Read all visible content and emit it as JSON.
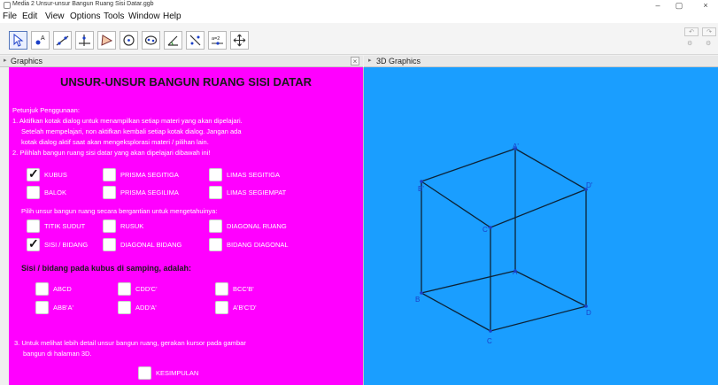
{
  "window": {
    "title": "Media 2 Unsur-unsur Bangun Ruang Sisi Datar.ggb",
    "controls": {
      "minimize": "–",
      "maximize": "▢",
      "close": "×"
    }
  },
  "menu": [
    "File",
    "Edit",
    "View",
    "Options",
    "Tools",
    "Window",
    "Help"
  ],
  "toolbar": {
    "tools": [
      {
        "icon": "move-arrow-icon"
      },
      {
        "icon": "point-icon"
      },
      {
        "icon": "line-icon"
      },
      {
        "icon": "perpendicular-line-icon"
      },
      {
        "icon": "polygon-icon"
      },
      {
        "icon": "circle-icon"
      },
      {
        "icon": "ellipse-icon"
      },
      {
        "icon": "angle-icon"
      },
      {
        "icon": "reflect-icon"
      },
      {
        "icon": "slider-icon",
        "label": "a=2"
      },
      {
        "icon": "move-view-icon"
      }
    ]
  },
  "panes": {
    "graphics": {
      "title": "Graphics",
      "close": "×"
    },
    "graphics3d": {
      "title": "3D Graphics"
    }
  },
  "content": {
    "heading": "UNSUR-UNSUR BANGUN RUANG SISI DATAR",
    "instructions": [
      "Petunjuk Penggunaan:",
      "1. Aktifkan kotak dialog untuk menampilkan setiap materi yang akan dipelajari.",
      "Setelah mempelajari, non aktifkan kembali setiap kotak dialog. Jangan ada",
      "kotak dialog aktif saat akan mengeksplorasi materi / pilihan lain.",
      "2. Pilihlah bangun ruang sisi datar yang akan dipelajari dibawah ini!"
    ],
    "shapes": [
      {
        "label": "KUBUS",
        "checked": true
      },
      {
        "label": "PRISMA SEGITIGA",
        "checked": false
      },
      {
        "label": "LIMAS SEGITIGA",
        "checked": false
      },
      {
        "label": "BALOK",
        "checked": false
      },
      {
        "label": "PRISMA SEGILIMA",
        "checked": false
      },
      {
        "label": "LIMAS SEGIEMPAT",
        "checked": false
      }
    ],
    "elements_prompt": "Pilih unsur bangun ruang secara bergantian untuk mengetahuinya:",
    "elements": [
      {
        "label": "TITIK SUDUT",
        "checked": false
      },
      {
        "label": "RUSUK",
        "checked": false
      },
      {
        "label": "DIAGONAL RUANG",
        "checked": false
      },
      {
        "label": "SISI / BIDANG",
        "checked": true
      },
      {
        "label": "DIAGONAL BIDANG",
        "checked": false
      },
      {
        "label": "BIDANG DIAGONAL",
        "checked": false
      }
    ],
    "faces_heading": "Sisi / bidang pada kubus di samping, adalah:",
    "faces": [
      {
        "label": "ABCD",
        "checked": false
      },
      {
        "label": "CDD'C'",
        "checked": false
      },
      {
        "label": "BCC'B'",
        "checked": false
      },
      {
        "label": "ABB'A'",
        "checked": false
      },
      {
        "label": "ADD'A'",
        "checked": false
      },
      {
        "label": "A'B'C'D'",
        "checked": false
      }
    ],
    "note": [
      "3. Untuk melihat lebih detail unsur bangun ruang, gerakan kursor pada gambar",
      "bangun di halaman 3D."
    ],
    "conclusion": {
      "label": "KESIMPULAN",
      "checked": false
    }
  },
  "cube": {
    "vertex_labels": [
      "A",
      "B",
      "C",
      "D",
      "A'",
      "B'",
      "C'",
      "D'"
    ],
    "edge_color": "#0d2236",
    "label_color": "#1a3fc8"
  }
}
